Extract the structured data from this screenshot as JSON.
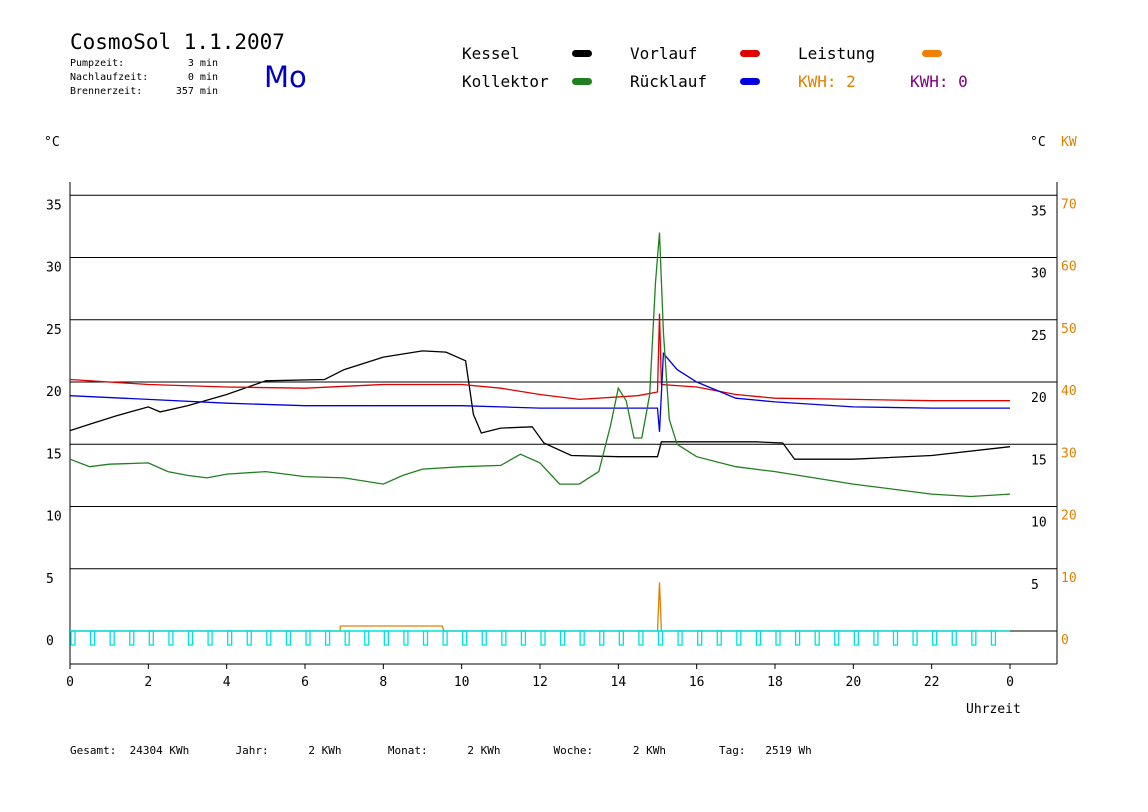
{
  "header": {
    "title": "CosmoSol 1.1.2007",
    "stats": [
      {
        "label": "Pumpzeit:",
        "value": "3 min"
      },
      {
        "label": "Nachlaufzeit:",
        "value": "0 min"
      },
      {
        "label": "Brennerzeit:",
        "value": "357 min"
      }
    ],
    "weekday": "Mo"
  },
  "legend": {
    "items": [
      {
        "label": "Kessel",
        "color": "#000000"
      },
      {
        "label": "Vorlauf",
        "color": "#e00000"
      },
      {
        "label": "Leistung",
        "color": "#f08000"
      },
      {
        "label": "Kollektor",
        "color": "#208020"
      },
      {
        "label": "Rücklauf",
        "color": "#0000e0"
      }
    ],
    "kwh_orange": "KWH: 2",
    "kwh_purple": "KWH: 0",
    "kwh_orange_color": "#e08000",
    "kwh_purple_color": "#800080"
  },
  "axes": {
    "left_unit": "°C",
    "right_unit_c": "°C",
    "right_unit_kw": "KW",
    "x_label": "Uhrzeit"
  },
  "footer": "Gesamt:  24304 KWh       Jahr:      2 KWh       Monat:      2 KWh        Woche:      2 KWh        Tag:   2519 Wh",
  "chart_data": {
    "type": "line",
    "x_label": "Uhrzeit",
    "x_ticks": [
      "0",
      "2",
      "4",
      "6",
      "8",
      "10",
      "12",
      "14",
      "16",
      "18",
      "20",
      "22",
      "0"
    ],
    "xlim": [
      0,
      24
    ],
    "ylim": [
      -2.5,
      36
    ],
    "y_left_ticks": [
      0,
      5,
      10,
      15,
      20,
      25,
      30,
      35
    ],
    "y_right_c_ticks": [
      5,
      10,
      15,
      20,
      25,
      30,
      35
    ],
    "y_right_kw_ticks": [
      0,
      10,
      20,
      30,
      40,
      50,
      60,
      70
    ],
    "series": [
      {
        "name": "Kessel",
        "color": "#000000",
        "points": [
          [
            0,
            16.1
          ],
          [
            0.5,
            16.6
          ],
          [
            1.2,
            17.3
          ],
          [
            2,
            18
          ],
          [
            2.3,
            17.6
          ],
          [
            3,
            18.1
          ],
          [
            4,
            19
          ],
          [
            5,
            20.1
          ],
          [
            6.5,
            20.2
          ],
          [
            7,
            21
          ],
          [
            8,
            22
          ],
          [
            9,
            22.5
          ],
          [
            9.6,
            22.4
          ],
          [
            10.1,
            21.7
          ],
          [
            10.3,
            17.4
          ],
          [
            10.5,
            15.9
          ],
          [
            11,
            16.3
          ],
          [
            11.8,
            16.4
          ],
          [
            12.1,
            15.1
          ],
          [
            12.8,
            14.1
          ],
          [
            14,
            14
          ],
          [
            15,
            14
          ],
          [
            15.1,
            15.2
          ],
          [
            16,
            15.2
          ],
          [
            17.5,
            15.2
          ],
          [
            18.2,
            15.1
          ],
          [
            18.5,
            13.8
          ],
          [
            20,
            13.8
          ],
          [
            22,
            14.1
          ],
          [
            24,
            14.8
          ]
        ]
      },
      {
        "name": "Vorlauf",
        "color": "#e00000",
        "points": [
          [
            0,
            20.2
          ],
          [
            2,
            19.8
          ],
          [
            4,
            19.6
          ],
          [
            6,
            19.5
          ],
          [
            8,
            19.8
          ],
          [
            10,
            19.8
          ],
          [
            11,
            19.5
          ],
          [
            12,
            19
          ],
          [
            13,
            18.6
          ],
          [
            14.5,
            18.9
          ],
          [
            15,
            19.2
          ],
          [
            15.05,
            25.5
          ],
          [
            15.1,
            19.8
          ],
          [
            16,
            19.6
          ],
          [
            17,
            19
          ],
          [
            18,
            18.7
          ],
          [
            20,
            18.6
          ],
          [
            22,
            18.5
          ],
          [
            24,
            18.5
          ]
        ]
      },
      {
        "name": "Rücklauf",
        "color": "#0000e0",
        "points": [
          [
            0,
            18.9
          ],
          [
            2,
            18.6
          ],
          [
            4,
            18.3
          ],
          [
            6,
            18.1
          ],
          [
            8,
            18.1
          ],
          [
            10,
            18.1
          ],
          [
            12,
            17.9
          ],
          [
            14,
            17.9
          ],
          [
            15,
            17.9
          ],
          [
            15.05,
            16
          ],
          [
            15.15,
            22.3
          ],
          [
            15.5,
            21
          ],
          [
            16,
            20
          ],
          [
            17,
            18.7
          ],
          [
            18,
            18.4
          ],
          [
            19,
            18.2
          ],
          [
            20,
            18
          ],
          [
            22,
            17.9
          ],
          [
            24,
            17.9
          ]
        ]
      },
      {
        "name": "Kollektor",
        "color": "#208020",
        "points": [
          [
            0,
            13.8
          ],
          [
            0.5,
            13.2
          ],
          [
            1,
            13.4
          ],
          [
            2,
            13.5
          ],
          [
            2.5,
            12.8
          ],
          [
            3,
            12.5
          ],
          [
            3.5,
            12.3
          ],
          [
            4,
            12.6
          ],
          [
            5,
            12.8
          ],
          [
            6,
            12.4
          ],
          [
            7,
            12.3
          ],
          [
            8,
            11.8
          ],
          [
            8.5,
            12.5
          ],
          [
            9,
            13
          ],
          [
            10,
            13.2
          ],
          [
            11,
            13.3
          ],
          [
            11.5,
            14.2
          ],
          [
            12,
            13.5
          ],
          [
            12.5,
            11.8
          ],
          [
            13,
            11.8
          ],
          [
            13.5,
            12.8
          ],
          [
            13.8,
            16.5
          ],
          [
            14,
            19.5
          ],
          [
            14.2,
            18.5
          ],
          [
            14.4,
            15.5
          ],
          [
            14.6,
            15.5
          ],
          [
            14.8,
            19
          ],
          [
            14.95,
            28
          ],
          [
            15.05,
            32
          ],
          [
            15.15,
            24
          ],
          [
            15.3,
            17
          ],
          [
            15.5,
            15
          ],
          [
            16,
            14
          ],
          [
            17,
            13.2
          ],
          [
            18,
            12.8
          ],
          [
            19,
            12.3
          ],
          [
            20,
            11.8
          ],
          [
            21,
            11.4
          ],
          [
            22,
            11
          ],
          [
            23,
            10.8
          ],
          [
            24,
            11
          ]
        ]
      },
      {
        "name": "Leistung",
        "color": "#e08000",
        "points": [
          [
            0,
            0
          ],
          [
            6.9,
            0
          ],
          [
            6.9,
            0.4
          ],
          [
            9.5,
            0.4
          ],
          [
            9.55,
            0
          ],
          [
            15.0,
            0
          ],
          [
            15.05,
            3.9
          ],
          [
            15.1,
            0
          ],
          [
            24,
            0
          ]
        ]
      },
      {
        "name": "Pumpe",
        "color": "#00e0e0",
        "pulses_h": [
          0,
          0.5,
          1.0,
          1.5,
          2.0,
          2.5,
          3.0,
          3.5,
          4.0,
          4.5,
          5.0,
          5.5,
          6.0,
          6.5,
          7.0,
          7.5,
          8.0,
          8.5,
          9.0,
          9.5,
          10.0,
          10.5,
          11.0,
          11.5,
          12.0,
          12.5,
          13.0,
          13.5,
          14.0,
          14.5,
          15.0,
          15.5,
          16.0,
          16.5,
          17.0,
          17.5,
          18.0,
          18.5,
          19.0,
          19.5,
          20.0,
          20.5,
          21.0,
          21.5,
          22.0,
          22.5,
          23.0,
          23.5
        ]
      }
    ]
  }
}
